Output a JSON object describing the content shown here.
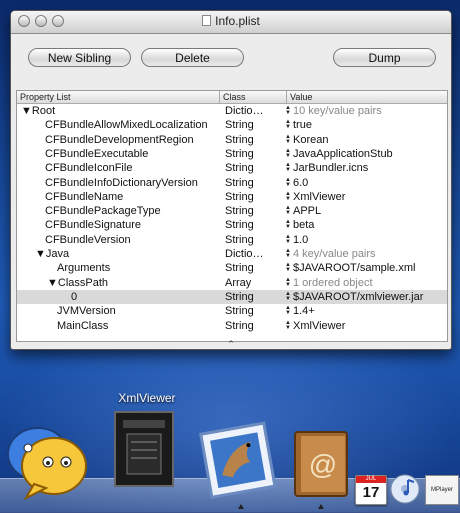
{
  "window": {
    "title": "Info.plist",
    "buttons": {
      "new_sibling": "New Sibling",
      "delete": "Delete",
      "dump": "Dump"
    },
    "columns": {
      "property": "Property List",
      "class": "Class",
      "value": "Value"
    },
    "rows": [
      {
        "name": "▼Root",
        "class": "Dictio…",
        "value": "10 key/value pairs",
        "grey": true
      },
      {
        "name": "CFBundleAllowMixedLocalization",
        "class": "String",
        "value": "true"
      },
      {
        "name": "CFBundleDevelopmentRegion",
        "class": "String",
        "value": "Korean"
      },
      {
        "name": "CFBundleExecutable",
        "class": "String",
        "value": "JavaApplicationStub"
      },
      {
        "name": "CFBundleIconFile",
        "class": "String",
        "value": "JarBundler.icns"
      },
      {
        "name": "CFBundleInfoDictionaryVersion",
        "class": "String",
        "value": "6.0"
      },
      {
        "name": "CFBundleName",
        "class": "String",
        "value": "XmlViewer"
      },
      {
        "name": "CFBundlePackageType",
        "class": "String",
        "value": "APPL"
      },
      {
        "name": "CFBundleSignature",
        "class": "String",
        "value": "beta"
      },
      {
        "name": "CFBundleVersion",
        "class": "String",
        "value": "1.0"
      },
      {
        "name": "▼Java",
        "class": "Dictio…",
        "value": "4 key/value pairs",
        "grey": true
      },
      {
        "name": "Arguments",
        "class": "String",
        "value": "$JAVAROOT/sample.xml"
      },
      {
        "name": "▼ClassPath",
        "class": "Array",
        "value": "1 ordered object",
        "grey": true
      },
      {
        "name": "0",
        "class": "String",
        "value": "$JAVAROOT/xmlviewer.jar",
        "selected": true
      },
      {
        "name": "JVMVersion",
        "class": "String",
        "value": "1.4+"
      },
      {
        "name": "MainClass",
        "class": "String",
        "value": "XmlViewer"
      }
    ]
  },
  "dock": {
    "label": "XmlViewer",
    "ical_day": "17",
    "ical_month": "JUL",
    "mplayer_label": "MPlayer",
    "icons": [
      "chat-icon",
      "book-icon",
      "mail-icon",
      "address-book-icon",
      "ical-icon",
      "itunes-icon",
      "mplayer-icon"
    ]
  },
  "colors": {
    "desktop": "#1f5dbb",
    "selection": "#d9d9d9"
  }
}
